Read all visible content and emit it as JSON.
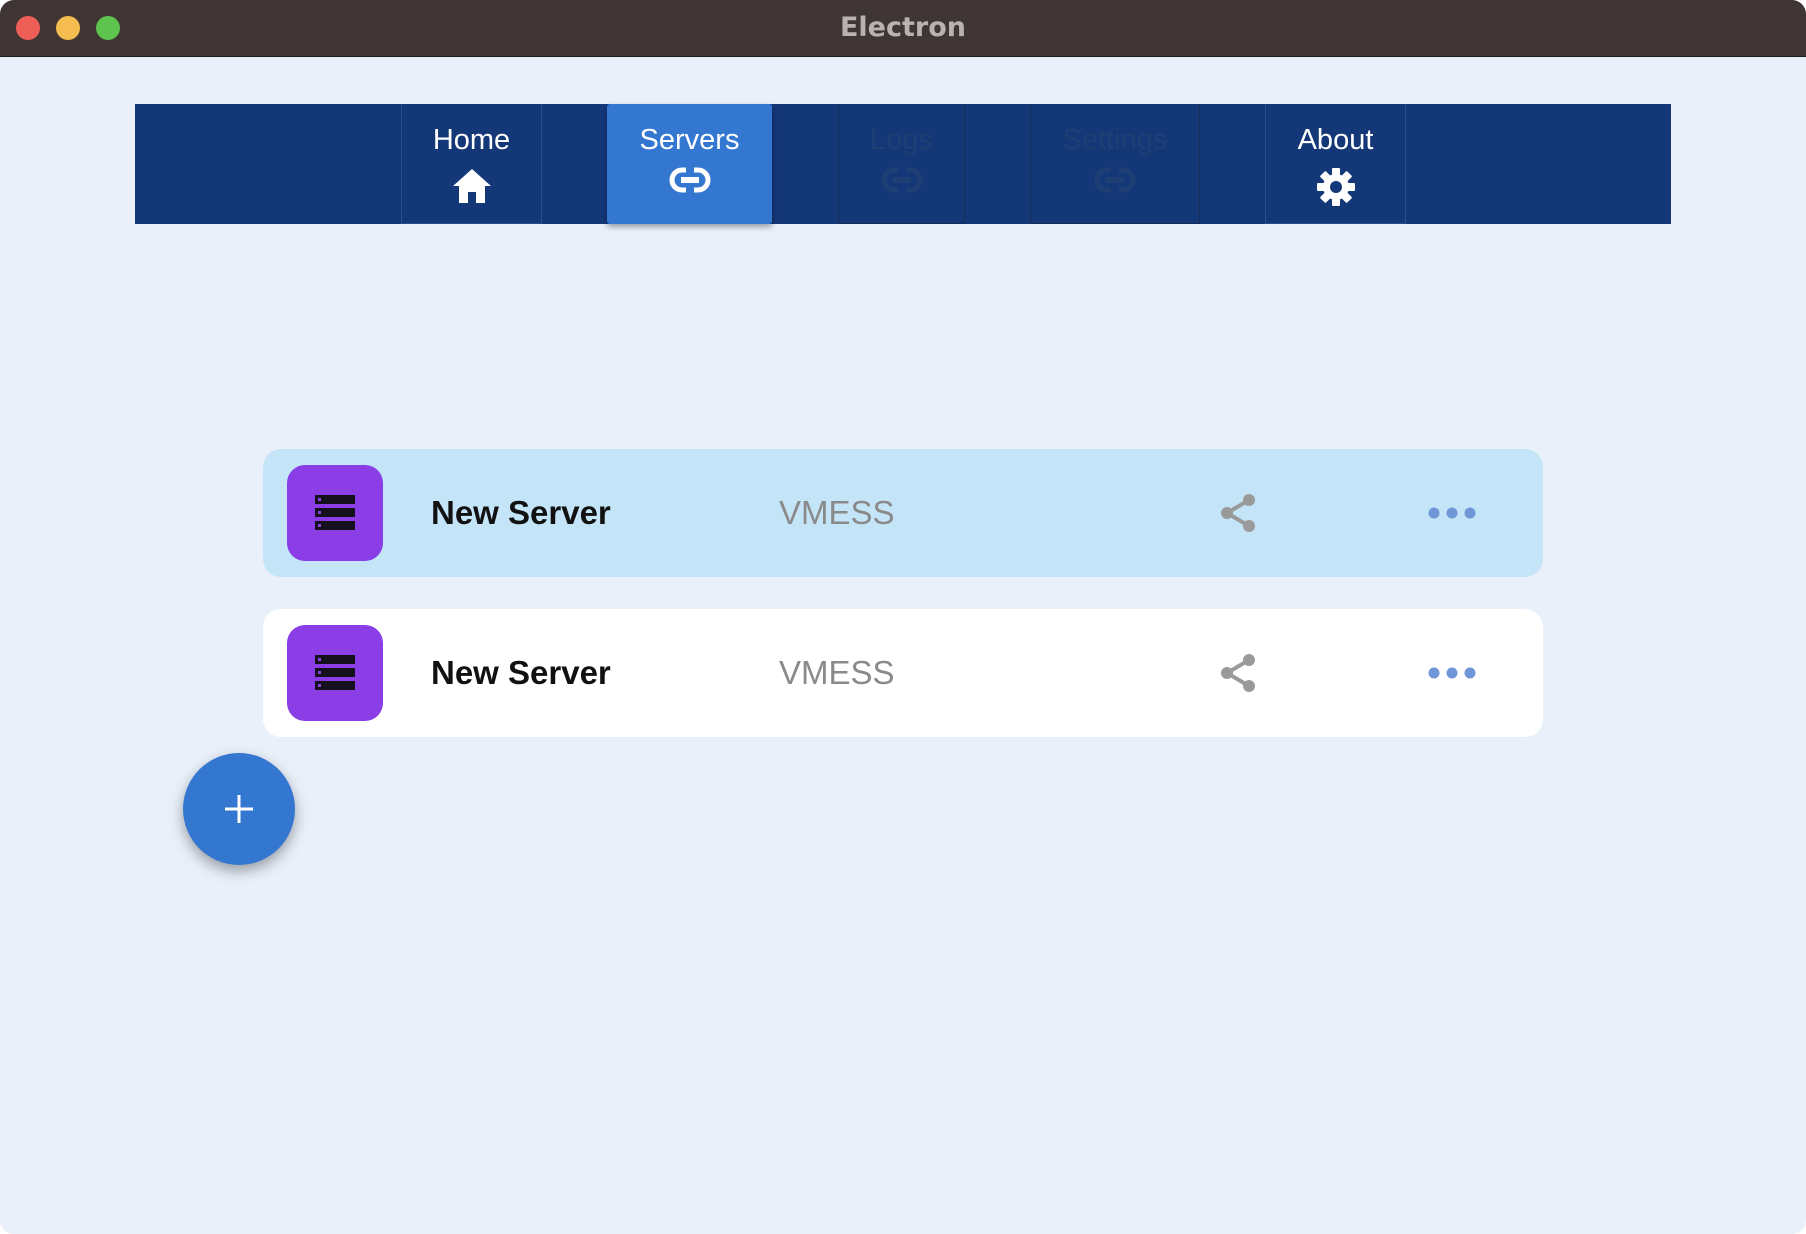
{
  "window": {
    "title": "Electron"
  },
  "nav": {
    "tabs": [
      {
        "label": "Home",
        "icon": "home-icon",
        "state": "normal"
      },
      {
        "label": "Servers",
        "icon": "link-icon",
        "state": "active"
      },
      {
        "label": "Logs",
        "icon": "link-icon",
        "state": "disabled"
      },
      {
        "label": "Settings",
        "icon": "link-icon",
        "state": "disabled"
      },
      {
        "label": "About",
        "icon": "gear-icon",
        "state": "normal"
      }
    ]
  },
  "servers": [
    {
      "name": "New Server",
      "protocol": "VMESS",
      "selected": true,
      "icon": "server-icon"
    },
    {
      "name": "New Server",
      "protocol": "VMESS",
      "selected": false,
      "icon": "server-icon"
    }
  ],
  "fab": {
    "icon": "plus-icon"
  },
  "colors": {
    "navbar": "#143778",
    "accent": "#3377d0",
    "avatar": "#8b3ee6",
    "selected_card": "#c4e4f8",
    "background": "#e9f0fa"
  }
}
